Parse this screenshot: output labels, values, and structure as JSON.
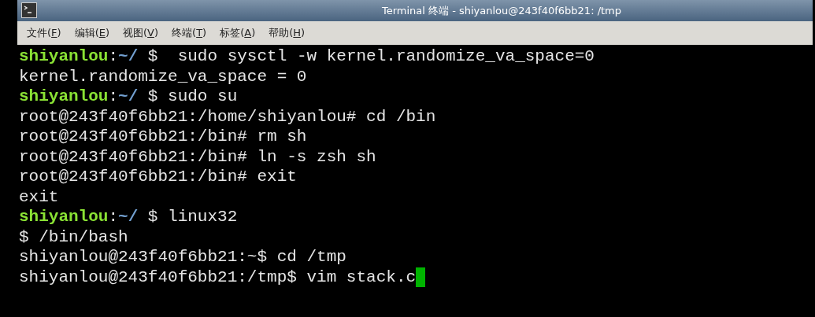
{
  "window": {
    "title": "Terminal 终端 - shiyanlou@243f40f6bb21: /tmp"
  },
  "menu": [
    {
      "before": "文件(",
      "key": "F",
      "after": ")"
    },
    {
      "before": "编辑(",
      "key": "E",
      "after": ")"
    },
    {
      "before": "视图(",
      "key": "V",
      "after": ")"
    },
    {
      "before": "终端(",
      "key": "T",
      "after": ")"
    },
    {
      "before": "标签(",
      "key": "A",
      "after": ")"
    },
    {
      "before": "帮助(",
      "key": "H",
      "after": ")"
    }
  ],
  "lines": [
    {
      "kind": "prompt",
      "user": "shiyanlou",
      "sep": ":",
      "path": "~/",
      "rest": " $  sudo sysctl -w kernel.randomize_va_space=0"
    },
    {
      "kind": "output",
      "text": "kernel.randomize_va_space = 0"
    },
    {
      "kind": "prompt",
      "user": "shiyanlou",
      "sep": ":",
      "path": "~/",
      "rest": " $ sudo su"
    },
    {
      "kind": "output",
      "text": "root@243f40f6bb21:/home/shiyanlou# cd /bin"
    },
    {
      "kind": "output",
      "text": "root@243f40f6bb21:/bin# rm sh"
    },
    {
      "kind": "output",
      "text": "root@243f40f6bb21:/bin# ln -s zsh sh"
    },
    {
      "kind": "output",
      "text": "root@243f40f6bb21:/bin# exit"
    },
    {
      "kind": "output",
      "text": "exit"
    },
    {
      "kind": "prompt",
      "user": "shiyanlou",
      "sep": ":",
      "path": "~/",
      "rest": " $ linux32"
    },
    {
      "kind": "output",
      "text": "$ /bin/bash"
    },
    {
      "kind": "output",
      "text": "shiyanlou@243f40f6bb21:~$ cd /tmp"
    },
    {
      "kind": "output",
      "text": "shiyanlou@243f40f6bb21:/tmp$ vim stack.c",
      "cursor": true
    }
  ]
}
